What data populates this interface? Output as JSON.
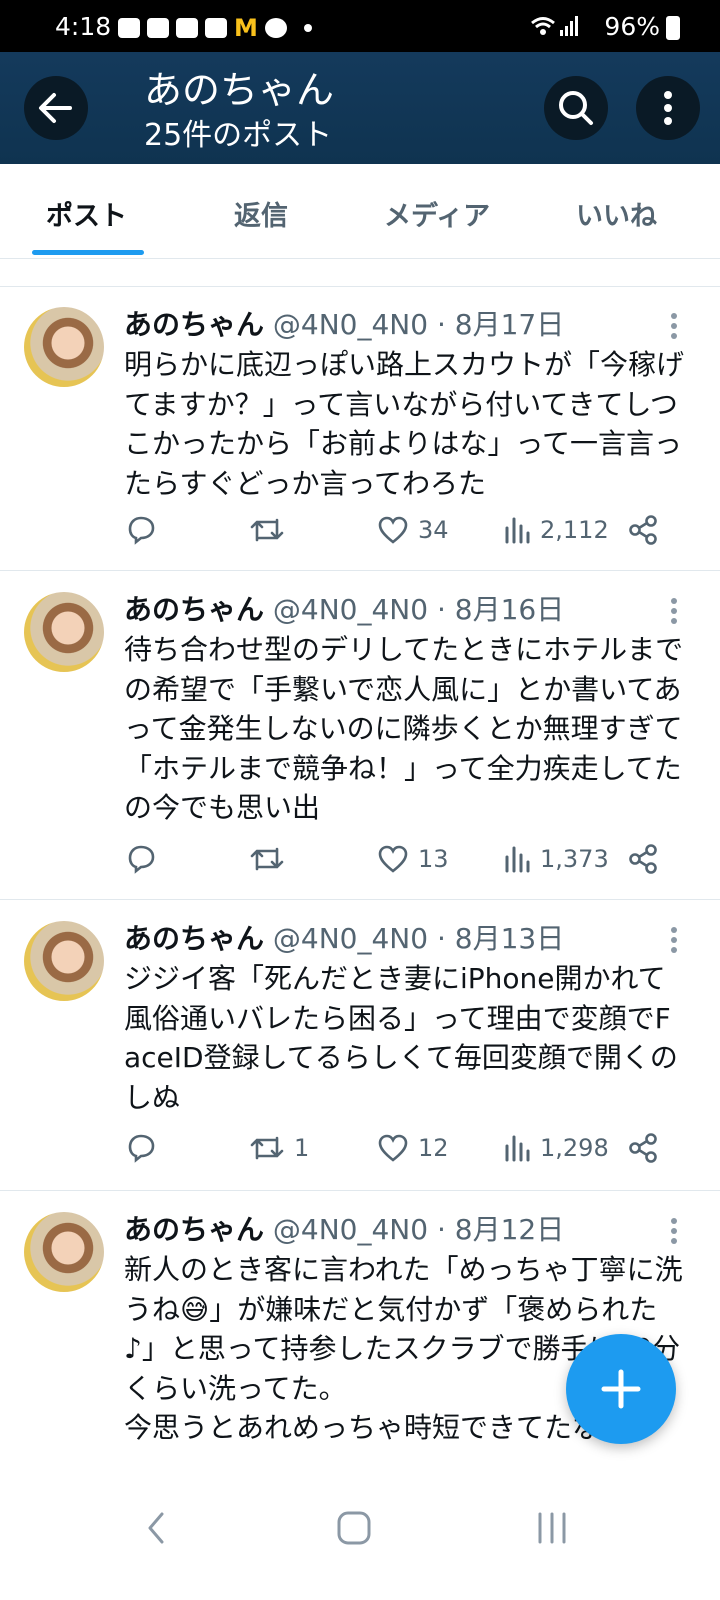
{
  "status_bar": {
    "time": "4:18",
    "battery": "96%",
    "app_icons": [
      "threads-icon",
      "box-icon",
      "flower-icon",
      "shield-icon",
      "mcdonalds-icon",
      "line-icon"
    ]
  },
  "header": {
    "title": "あのちゃん",
    "subtitle": "25件のポスト"
  },
  "tabs": [
    {
      "label": "ポスト",
      "active": true
    },
    {
      "label": "返信",
      "active": false
    },
    {
      "label": "メディア",
      "active": false
    },
    {
      "label": "いいね",
      "active": false
    }
  ],
  "posts": [
    {
      "name": "あのちゃん",
      "handle": "@4N0_4N0",
      "date": "8月17日",
      "meta": "@4N0_4N0 · 8月17日",
      "text": "明らかに底辺っぽい路上スカウトが「今稼げてますか？」って言いながら付いてきてしつこかったから「お前よりはな」って一言言ったらすぐどっか言ってわろた",
      "reposts": "",
      "likes": "34",
      "views": "2,112"
    },
    {
      "name": "あのちゃん",
      "handle": "@4N0_4N0",
      "date": "8月16日",
      "meta": "@4N0_4N0 · 8月16日",
      "text": "待ち合わせ型のデリしてたときにホテルまでの希望で「手繋いで恋人風に」とか書いてあって金発生しないのに隣歩くとか無理すぎて「ホテルまで競争ね！」って全力疾走してたの今でも思い出",
      "reposts": "",
      "likes": "13",
      "views": "1,373"
    },
    {
      "name": "あのちゃん",
      "handle": "@4N0_4N0",
      "date": "8月13日",
      "meta": "@4N0_4N0 · 8月13日",
      "text": "ジジイ客「死んだとき妻にiPhone開かれて風俗通いバレたら困る」って理由で変顔でFaceID登録してるらしくて毎回変顔で開くのしぬ",
      "reposts": "1",
      "likes": "12",
      "views": "1,298"
    },
    {
      "name": "あのちゃん",
      "handle": "@4N0_4N0",
      "date": "8月12日",
      "meta": "@4N0_4N0 · 8月12日",
      "text": "新人のとき客に言われた「めっちゃ丁寧に洗うね😅」が嫌味だと気付かず「褒められた♪」と思って持参したスクラブで勝手に10分くらい洗ってた。\n今思うとあれめっちゃ時短できてたな",
      "reposts": "",
      "likes": "",
      "views": ""
    }
  ],
  "colors": {
    "accent": "#1d9bf0",
    "header_bg": "#143a5c",
    "text": "#0f1419",
    "muted": "#536471"
  }
}
